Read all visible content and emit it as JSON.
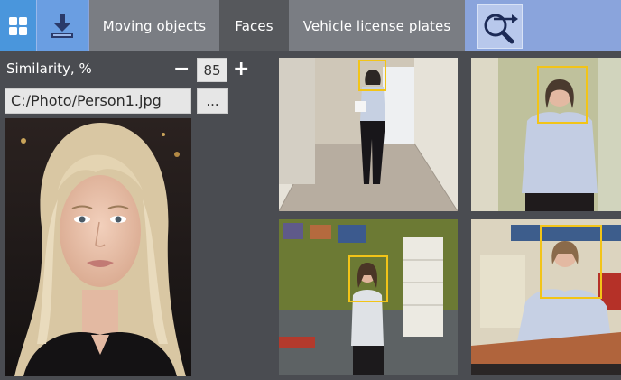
{
  "toolbar": {
    "tabs": [
      {
        "label": "Moving objects",
        "active": false
      },
      {
        "label": "Faces",
        "active": true
      },
      {
        "label": "Vehicle license plates",
        "active": false
      }
    ],
    "buttons": {
      "grid_icon": "grid-icon",
      "export_icon": "download-icon",
      "search_icon": "search-arrow-icon"
    }
  },
  "search_panel": {
    "similarity_label": "Similarity, %",
    "similarity_value": "85",
    "minus_label": "−",
    "plus_label": "+",
    "file_path": "C:/Photo/Person1.jpg",
    "browse_label": "..."
  },
  "colors": {
    "toolbar_bg": "#8aa4dc",
    "active_tab": "#56585c",
    "inactive_tab": "#7a7d83",
    "face_highlight": "#f2c418",
    "panel_bg": "#4a4c51"
  },
  "results": [
    {
      "id": "camera-1"
    },
    {
      "id": "camera-2"
    },
    {
      "id": "camera-3"
    },
    {
      "id": "camera-4"
    }
  ]
}
